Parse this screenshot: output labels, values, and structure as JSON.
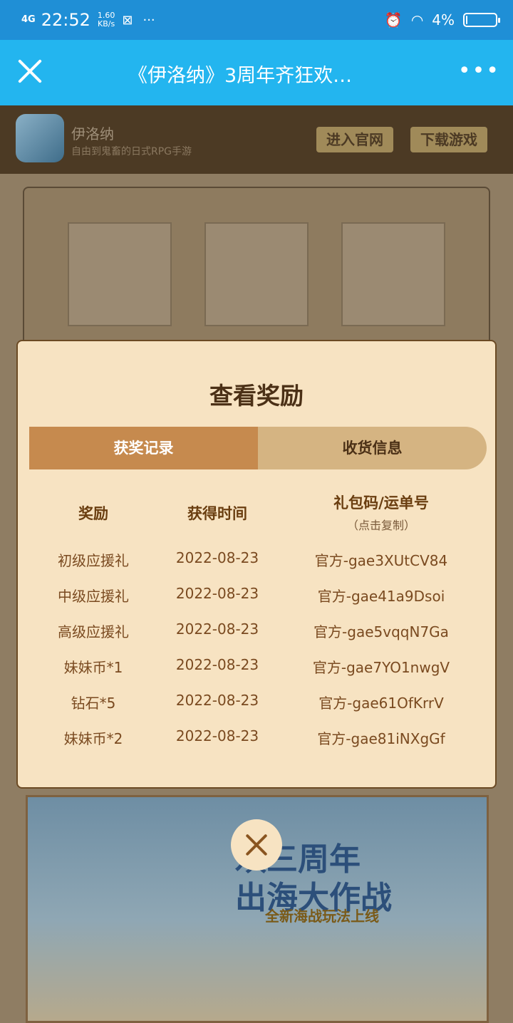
{
  "status_bar": {
    "network": "4G",
    "time": "22:52",
    "speed_value": "1.60",
    "speed_unit": "KB/s",
    "more": "···",
    "battery": "4%",
    "battery_level_percent": 4
  },
  "title_bar": {
    "title": "《伊洛纳》3周年齐狂欢…",
    "more": "•••"
  },
  "app_bar": {
    "name": "伊洛纳",
    "subtitle": "自由到鬼畜的日式RPG手游",
    "enter_site_label": "进入官网",
    "download_label": "下载游戏"
  },
  "modal": {
    "title": "查看奖励",
    "tabs": [
      {
        "label": "获奖记录",
        "active": true
      },
      {
        "label": "收货信息",
        "active": false
      }
    ],
    "columns": {
      "reward": "奖励",
      "time": "获得时间",
      "code": "礼包码/运单号",
      "code_hint": "（点击复制）"
    },
    "rows": [
      {
        "reward": "初级应援礼",
        "time": "2022-08-23",
        "code": "官方-gae3XUtCV84"
      },
      {
        "reward": "中级应援礼",
        "time": "2022-08-23",
        "code": "官方-gae41a9Dsoi"
      },
      {
        "reward": "高级应援礼",
        "time": "2022-08-23",
        "code": "官方-gae5vqqN7Ga"
      },
      {
        "reward": "妹妹币*1",
        "time": "2022-08-23",
        "code": "官方-gae7YO1nwgV"
      },
      {
        "reward": "钻石*5",
        "time": "2022-08-23",
        "code": "官方-gae61OfKrrV"
      },
      {
        "reward": "妹妹币*2",
        "time": "2022-08-23",
        "code": "官方-gae81iNXgGf"
      }
    ]
  },
  "banner": {
    "headline_line1": "欢三周年",
    "headline_line2": "出海大作战",
    "tagline": "全新海战玩法上线"
  },
  "colors": {
    "status_bar": "#1f8fd6",
    "title_bar": "#23b5ef",
    "modal_bg": "#f7e3c2",
    "tab_active": "#c68a4e",
    "tab_inactive": "#d5b482"
  }
}
